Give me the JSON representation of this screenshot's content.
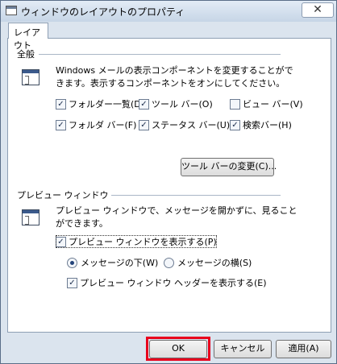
{
  "window": {
    "title": "ウィンドウのレイアウトのプロパティ",
    "close_glyph": "✕"
  },
  "tab": {
    "label": "レイアウト"
  },
  "basic": {
    "label": "全般",
    "line1": "Windows メールの表示コンポーネントを変更することがで",
    "line2": "きます。表示するコンポーネントをオンにしてください。",
    "checks": [
      {
        "label": "フォルダー一覧(D)",
        "checked": true
      },
      {
        "label": "ツール バー(O)",
        "checked": true
      },
      {
        "label": "ビュー バー(V)",
        "checked": false
      },
      {
        "label": "フォルダ バー(F)",
        "checked": true
      },
      {
        "label": "ステータス バー(U)",
        "checked": true
      },
      {
        "label": "検索バー(H)",
        "checked": true
      }
    ],
    "toolbar_button": "ツール バーの変更(C)..."
  },
  "preview": {
    "label": "プレビュー ウィンドウ",
    "line1": "プレビュー ウィンドウで、メッセージを開かずに、見ること",
    "line2": "ができます。",
    "show_pane": "プレビュー ウィンドウを表示する(P)",
    "below": "メッセージの下(W)",
    "beside": "メッセージの横(S)",
    "header": "プレビュー ウィンドウ ヘッダーを表示する(E)"
  },
  "buttons": {
    "ok": "OK",
    "cancel": "キャンセル",
    "apply": "適用(A)"
  },
  "colors": {
    "highlight": "#e8001c",
    "frame": "#dbe4ee"
  }
}
